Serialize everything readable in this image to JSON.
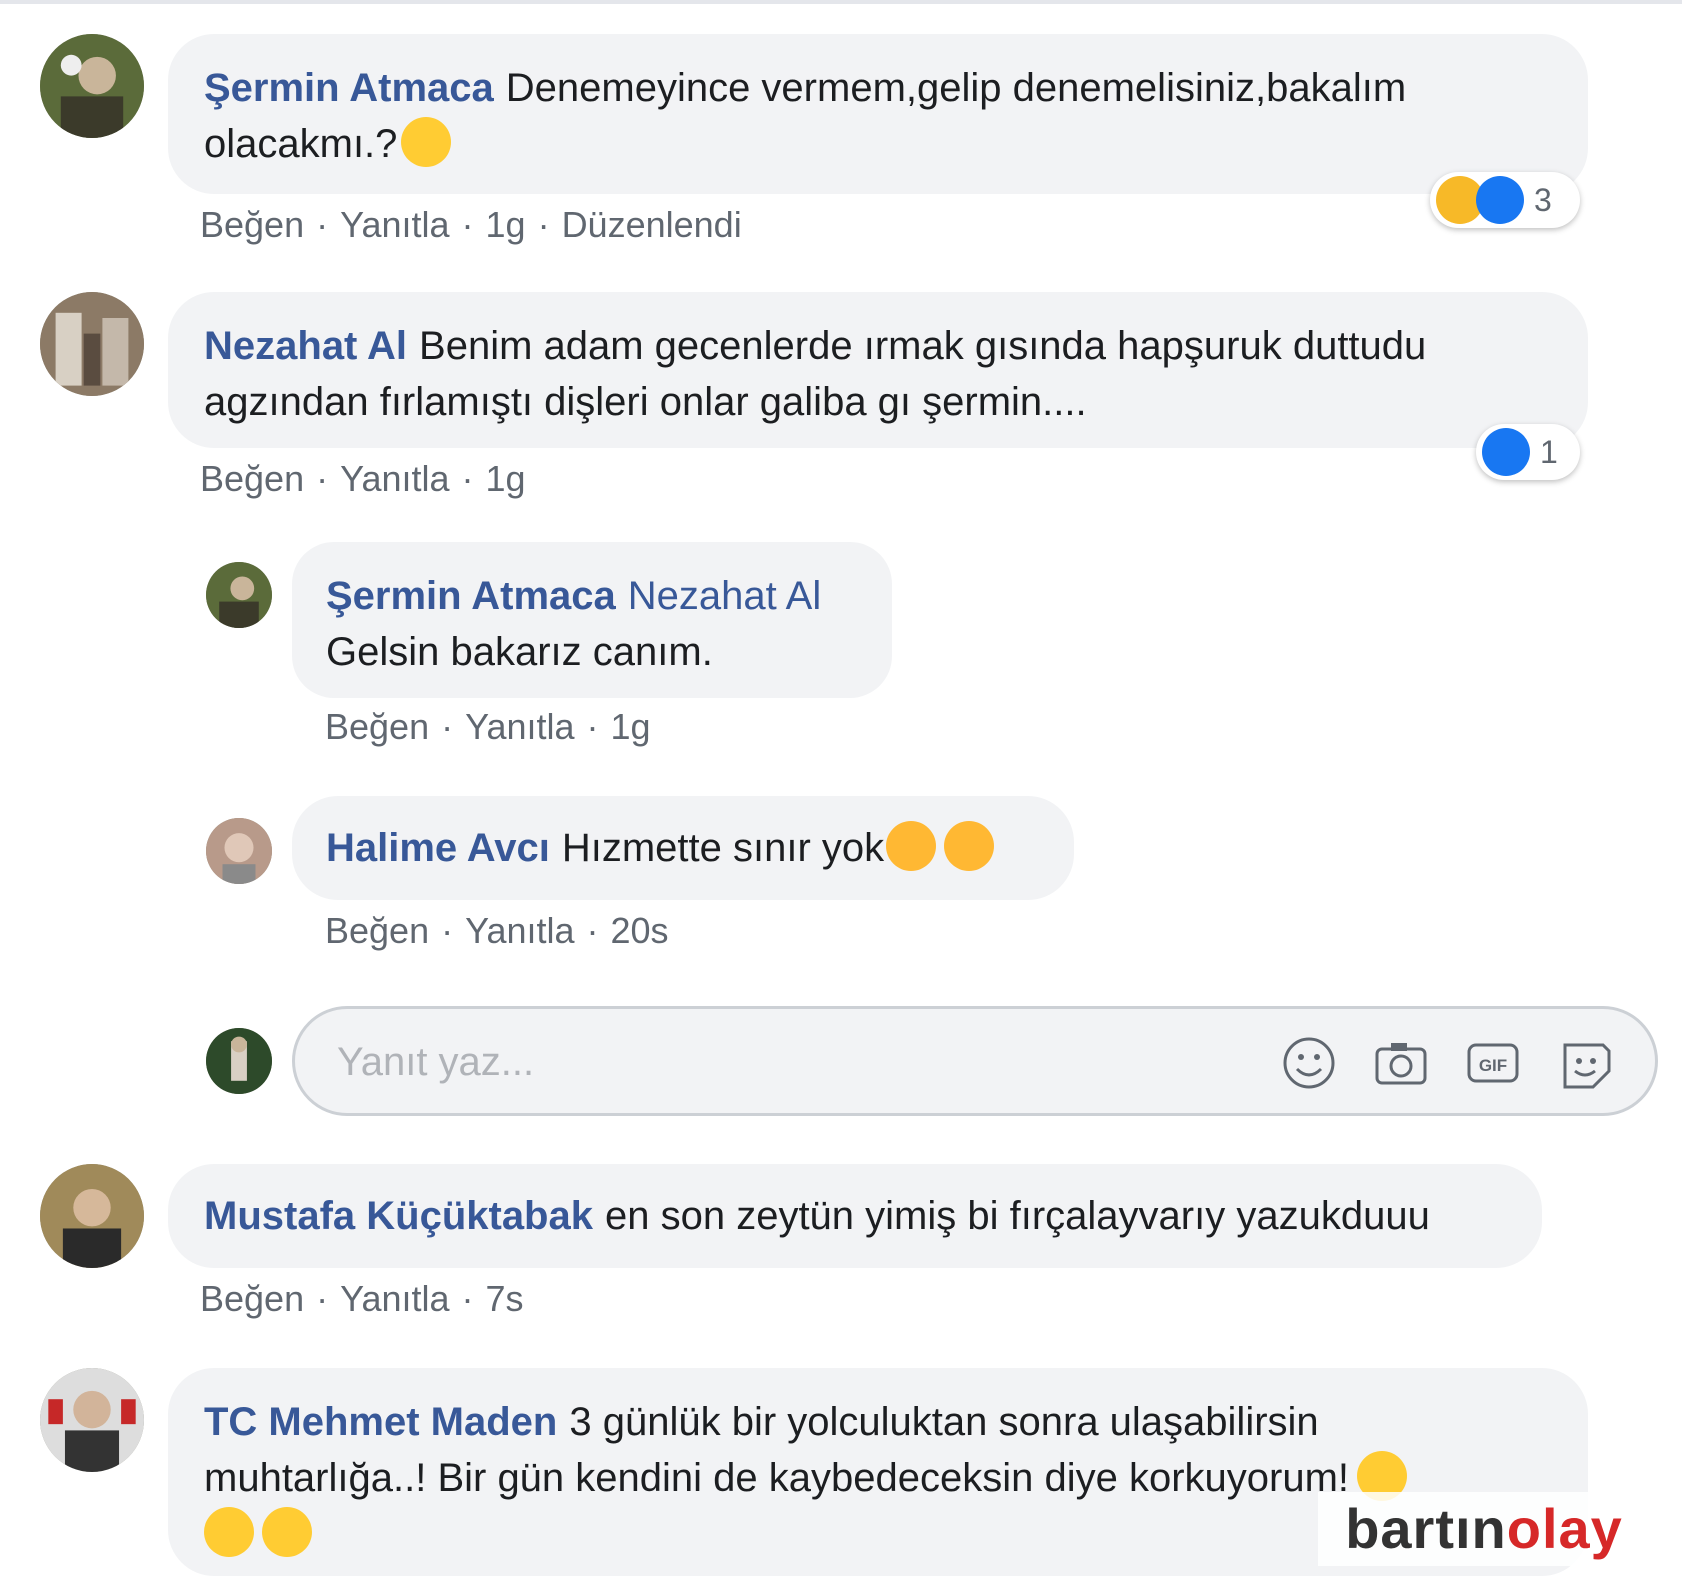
{
  "comments": [
    {
      "author": "Şermin Atmaca",
      "text": "Denemeyince vermem,gelip denemelisiniz,bakalım olacakmı.?",
      "actions": {
        "like": "Beğen",
        "reply": "Yanıtla",
        "time": "1g",
        "edited": "Düzenlendi"
      },
      "reaction_count": "3"
    },
    {
      "author": "Nezahat Al",
      "text": "Benim adam gecenlerde ırmak gısında hapşuruk duttudu agzından fırlamıştı dişleri onlar galiba gı şermin....",
      "actions": {
        "like": "Beğen",
        "reply": "Yanıtla",
        "time": "1g"
      },
      "reaction_count": "1"
    },
    {
      "author": "Mustafa Küçüktabak",
      "text": "en son zeytün yimiş bi fırçalayvarıy yazukduuu",
      "actions": {
        "like": "Beğen",
        "reply": "Yanıtla",
        "time": "7s"
      }
    },
    {
      "author": "TC Mehmet Maden",
      "text": "3 günlük bir yolculuktan sonra ulaşabilirsin muhtarlığa..! Bir gün kendini de kaybedeceksin diye korkuyorum!"
    }
  ],
  "replies": [
    {
      "author": "Şermin Atmaca",
      "tagged": "Nezahat Al",
      "text": "Gelsin bakarız canım.",
      "actions": {
        "like": "Beğen",
        "reply": "Yanıtla",
        "time": "1g"
      }
    },
    {
      "author": "Halime Avcı",
      "text": "Hızmette sınır yok",
      "actions": {
        "like": "Beğen",
        "reply": "Yanıtla",
        "time": "20s"
      }
    }
  ],
  "reply_box": {
    "placeholder": "Yanıt yaz..."
  },
  "watermark": {
    "part1": "bartın",
    "part2": "olay"
  },
  "colors": {
    "author": "#385898",
    "bubble": "#f2f3f5",
    "meta": "#606770",
    "like_blue": "#1877f2"
  }
}
